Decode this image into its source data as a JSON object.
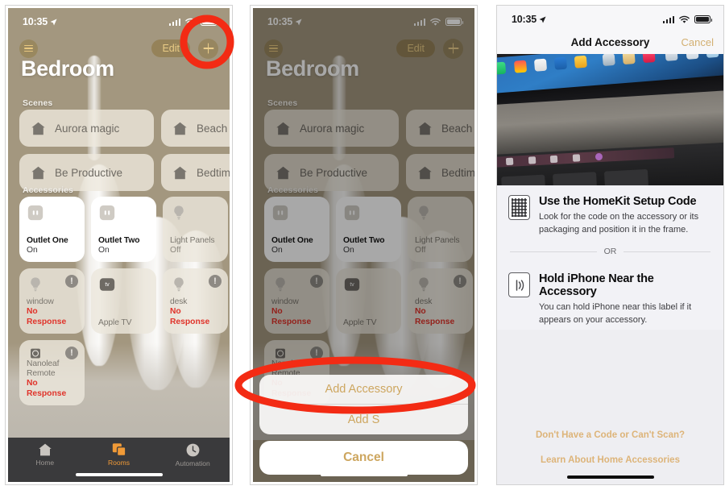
{
  "panels": {
    "left": {
      "status": {
        "time": "10:35",
        "location_icon": "location-arrow-icon"
      },
      "nav": {
        "menu_icon": "list-menu-icon",
        "edit_label": "Edit",
        "add_icon": "plus-icon"
      },
      "room_title": "Bedroom",
      "scenes_label": "Scenes",
      "accessories_label": "Accessories",
      "scenes": [
        {
          "name": "Aurora magic"
        },
        {
          "name": "Beach Wa"
        },
        {
          "name": "Be Productive"
        },
        {
          "name": "Bedtime"
        }
      ],
      "accessories": [
        {
          "name": "Outlet One",
          "state": "On",
          "icon": "outlet-icon",
          "on": true,
          "warn": false
        },
        {
          "name": "Outlet Two",
          "state": "On",
          "icon": "outlet-icon",
          "on": true,
          "warn": false
        },
        {
          "name": "Light Panels",
          "state": "Off",
          "icon": "bulb-icon",
          "on": false,
          "warn": false
        },
        {
          "name": "window",
          "state": "No Response",
          "icon": "bulb-icon",
          "on": false,
          "warn": true
        },
        {
          "name": "Apple TV",
          "state": "",
          "icon": "appletv-icon",
          "on": false,
          "warn": false
        },
        {
          "name": "desk",
          "state": "No Response",
          "icon": "bulb-icon",
          "on": false,
          "warn": true
        },
        {
          "name": "Nanoleaf Remote",
          "state": "No Response",
          "icon": "nanoleaf-icon",
          "on": false,
          "warn": true
        }
      ],
      "tabs": [
        {
          "label": "Home",
          "icon": "home-icon",
          "active": false
        },
        {
          "label": "Rooms",
          "icon": "rooms-icon",
          "active": true
        },
        {
          "label": "Automation",
          "icon": "automation-icon",
          "active": false
        }
      ]
    },
    "middle": {
      "status": {
        "time": "10:35",
        "location_icon": "location-arrow-icon"
      },
      "nav": {
        "menu_icon": "list-menu-icon",
        "edit_label": "Edit",
        "add_icon": "plus-icon"
      },
      "room_title": "Bedroom",
      "scenes_label": "Scenes",
      "accessories_label": "Accessories",
      "action_sheet": {
        "items": [
          {
            "label": "Add Accessory"
          },
          {
            "label": "Add S"
          }
        ],
        "cancel_label": "Cancel"
      }
    },
    "right": {
      "status": {
        "time": "10:35",
        "location_icon": "location-arrow-icon"
      },
      "nav": {
        "title": "Add Accessory",
        "cancel_label": "Cancel"
      },
      "camera_preview": "macbook-photo",
      "options": [
        {
          "icon": "qr-code-icon",
          "heading": "Use the HomeKit Setup Code",
          "body": "Look for the code on the accessory or its packaging and position it in the frame."
        },
        {
          "icon": "nfc-tag-icon",
          "heading": "Hold iPhone Near the Accessory",
          "body": "You can hold iPhone near this label if it appears on your accessory."
        }
      ],
      "divider_label": "OR",
      "links": [
        "Don't Have a Code or Can't Scan?",
        "Learn About Home Accessories"
      ]
    }
  },
  "annotations": {
    "circle_target": "plus-icon",
    "ellipse_target": "add-accessory-sheet-item",
    "color": "#f32b14"
  }
}
